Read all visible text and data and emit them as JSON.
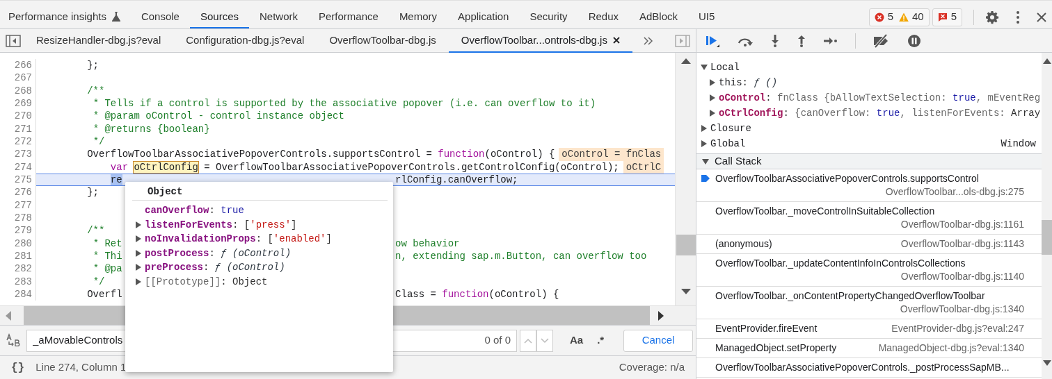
{
  "main_tabs": [
    {
      "label": "Performance insights",
      "kind": "experimental",
      "selected": false
    },
    {
      "label": "Console",
      "kind": "standard",
      "selected": false
    },
    {
      "label": "Sources",
      "kind": "standard",
      "selected": true
    },
    {
      "label": "Network",
      "kind": "standard",
      "selected": false
    },
    {
      "label": "Performance",
      "kind": "standard",
      "selected": false
    },
    {
      "label": "Memory",
      "kind": "standard",
      "selected": false
    },
    {
      "label": "Application",
      "kind": "standard",
      "selected": false
    },
    {
      "label": "Security",
      "kind": "standard",
      "selected": false
    },
    {
      "label": "Redux",
      "kind": "standard",
      "selected": false
    },
    {
      "label": "AdBlock",
      "kind": "standard",
      "selected": false
    },
    {
      "label": "UI5",
      "kind": "standard",
      "selected": false
    }
  ],
  "counters": [
    {
      "items": [
        {
          "kind": "error",
          "count": "5"
        },
        {
          "kind": "warning",
          "count": "40"
        }
      ]
    },
    {
      "items": [
        {
          "kind": "issue",
          "count": "5"
        }
      ]
    }
  ],
  "file_tabs": [
    {
      "label": "ResizeHandler-dbg.js?eval",
      "selected": false
    },
    {
      "label": "Configuration-dbg.js?eval",
      "selected": false
    },
    {
      "label": "OverflowToolbar-dbg.js",
      "selected": false
    },
    {
      "label": "OverflowToolbar...ontrols-dbg.js",
      "selected": true
    }
  ],
  "editor": {
    "lines": [
      {
        "number": "266",
        "paused": false,
        "parts": [
          {
            "kind": "code",
            "text": "        };"
          }
        ]
      },
      {
        "number": "267",
        "paused": false
      },
      {
        "number": "268",
        "paused": false,
        "parts": [
          {
            "kind": "comment",
            "text": "        /**"
          }
        ]
      },
      {
        "number": "269",
        "paused": false,
        "parts": [
          {
            "kind": "comment",
            "text": "         * Tells if a control is supported by the associative popover (i.e. can overflow to it)"
          }
        ]
      },
      {
        "number": "270",
        "paused": false,
        "parts": [
          {
            "kind": "comment",
            "text": "         * @param oControl - control instance object"
          }
        ]
      },
      {
        "number": "271",
        "paused": false,
        "parts": [
          {
            "kind": "comment",
            "text": "         * @returns {boolean}"
          }
        ]
      },
      {
        "number": "272",
        "paused": false,
        "parts": [
          {
            "kind": "comment",
            "text": "         */"
          }
        ]
      },
      {
        "number": "273",
        "paused": false,
        "parts": [
          {
            "kind": "code",
            "text": "        OverflowToolbarAssociativePopoverControls.supportsControl = "
          },
          {
            "kind": "keyword",
            "text": "function"
          },
          {
            "kind": "code",
            "text": "(oControl) {"
          }
        ],
        "inline_value": "oControl = fnClas"
      },
      {
        "number": "274",
        "paused": false,
        "parts": [
          {
            "kind": "keyword",
            "text": "            var "
          },
          {
            "kind": "box",
            "text": "oCtrlConfig"
          },
          {
            "kind": "code",
            "text": " = OverflowToolbarAssociativePopoverControls.getControlConfig(oControl);"
          }
        ],
        "inline_value": "oCtrlC"
      },
      {
        "number": "275",
        "paused": true,
        "parts": [
          {
            "kind": "selection",
            "text": "            re"
          }
        ],
        "after": [
          {
            "kind": "code",
            "text": "rlConfig.canOverflow;"
          }
        ]
      },
      {
        "number": "276",
        "paused": false,
        "parts": [
          {
            "kind": "code",
            "text": "        };"
          }
        ]
      },
      {
        "number": "277",
        "paused": false
      },
      {
        "number": "278",
        "paused": false
      },
      {
        "number": "279",
        "paused": false,
        "parts": [
          {
            "kind": "comment",
            "text": "        /**"
          }
        ]
      },
      {
        "number": "280",
        "paused": false,
        "parts": [
          {
            "kind": "comment",
            "text": "         * Ret"
          }
        ],
        "after": [
          {
            "kind": "comment",
            "text": "ow behavior"
          }
        ]
      },
      {
        "number": "281",
        "paused": false,
        "parts": [
          {
            "kind": "comment",
            "text": "         * Thi"
          }
        ],
        "after": [
          {
            "kind": "comment",
            "text": "n, extending sap.m.Button, can overflow too"
          }
        ]
      },
      {
        "number": "282",
        "paused": false,
        "parts": [
          {
            "kind": "comment",
            "text": "         * @pa"
          }
        ]
      },
      {
        "number": "283",
        "paused": false,
        "parts": [
          {
            "kind": "comment",
            "text": "         */"
          }
        ]
      },
      {
        "number": "284",
        "paused": false,
        "parts": [
          {
            "kind": "code",
            "text": "        Overfl"
          }
        ],
        "after": [
          {
            "kind": "code",
            "text": "Class = "
          },
          {
            "kind": "keyword",
            "text": "function"
          },
          {
            "kind": "code",
            "text": "(oControl) {"
          }
        ]
      }
    ]
  },
  "popover": {
    "title": "Object",
    "rows": [
      {
        "expandable": false,
        "parts": [
          {
            "kind": "prop",
            "text": "canOverflow"
          },
          {
            "kind": "punct",
            "text": ": "
          },
          {
            "kind": "bool",
            "text": "true"
          }
        ]
      },
      {
        "expandable": true,
        "parts": [
          {
            "kind": "prop",
            "text": "listenForEvents"
          },
          {
            "kind": "punct",
            "text": ": ["
          },
          {
            "kind": "string",
            "text": "'press'"
          },
          {
            "kind": "punct",
            "text": "]"
          }
        ]
      },
      {
        "expandable": true,
        "parts": [
          {
            "kind": "prop",
            "text": "noInvalidationProps"
          },
          {
            "kind": "punct",
            "text": ": ["
          },
          {
            "kind": "string",
            "text": "'enabled'"
          },
          {
            "kind": "punct",
            "text": "]"
          }
        ]
      },
      {
        "expandable": true,
        "parts": [
          {
            "kind": "prop",
            "text": "postProcess"
          },
          {
            "kind": "punct",
            "text": ": "
          },
          {
            "kind": "fn",
            "text": "ƒ (oControl)"
          }
        ]
      },
      {
        "expandable": true,
        "parts": [
          {
            "kind": "prop",
            "text": "preProcess"
          },
          {
            "kind": "punct",
            "text": ": "
          },
          {
            "kind": "fn",
            "text": "ƒ (oControl)"
          }
        ]
      },
      {
        "expandable": true,
        "parts": [
          {
            "kind": "dim",
            "text": "[[Prototype]]"
          },
          {
            "kind": "punct",
            "text": ": Object"
          }
        ]
      }
    ]
  },
  "search": {
    "value": "_aMovableControls",
    "match_count": "0 of 0",
    "case_label": "Aa",
    "regex_label": ".*",
    "cancel_label": "Cancel"
  },
  "status_bar": {
    "pretty_print": "{}",
    "cursor": "Line 274, Column 1",
    "coverage": "Coverage: n/a"
  },
  "scope": [
    {
      "label": "Local",
      "expanded": true,
      "children": [
        {
          "expanded": false,
          "parts": [
            {
              "kind": "plain",
              "text": "this"
            },
            {
              "kind": "punct",
              "text": ": "
            },
            {
              "kind": "fn",
              "text": "ƒ ()"
            }
          ]
        },
        {
          "expanded": false,
          "parts": [
            {
              "kind": "name",
              "text": "oControl"
            },
            {
              "kind": "punct",
              "text": ": "
            },
            {
              "kind": "dim",
              "text": "fnClass {bAllowTextSelection: "
            },
            {
              "kind": "bool",
              "text": "true"
            },
            {
              "kind": "dim",
              "text": ", mEventReg"
            }
          ]
        },
        {
          "expanded": false,
          "parts": [
            {
              "kind": "name",
              "text": "oCtrlConfig"
            },
            {
              "kind": "punct",
              "text": ": "
            },
            {
              "kind": "dim",
              "text": "{canOverflow: "
            },
            {
              "kind": "bool",
              "text": "true"
            },
            {
              "kind": "dim",
              "text": ", listenForEvents: "
            },
            {
              "kind": "punct",
              "text": "Array"
            }
          ]
        }
      ]
    },
    {
      "label": "Closure",
      "expanded": false
    },
    {
      "label": "Global",
      "expanded": false,
      "value": "Window"
    }
  ],
  "call_stack": {
    "title": "Call Stack",
    "expanded": true,
    "frames": [
      {
        "function": "OverflowToolbarAssociativePopoverControls.supportsControl",
        "location": "OverflowToolbar...ols-dbg.js:275",
        "selected": true
      },
      {
        "function": "OverflowToolbar._moveControlInSuitableCollection",
        "location": "OverflowToolbar-dbg.js:1161",
        "selected": false
      },
      {
        "function": "(anonymous)",
        "location": "OverflowToolbar-dbg.js:1143",
        "selected": false
      },
      {
        "function": "OverflowToolbar._updateContentInfoInControlsCollections",
        "location": "OverflowToolbar-dbg.js:1140",
        "selected": false
      },
      {
        "function": "OverflowToolbar._onContentPropertyChangedOverflowToolbar",
        "location": "OverflowToolbar-dbg.js:1340",
        "selected": false
      },
      {
        "function": "EventProvider.fireEvent",
        "location": "EventProvider-dbg.js?eval:247",
        "selected": false
      },
      {
        "function": "ManagedObject.setProperty",
        "location": "ManagedObject-dbg.js?eval:1340",
        "selected": false
      },
      {
        "function": "OverflowToolbarAssociativePopoverControls._postProcessSapMB...",
        "selected": false
      }
    ]
  }
}
